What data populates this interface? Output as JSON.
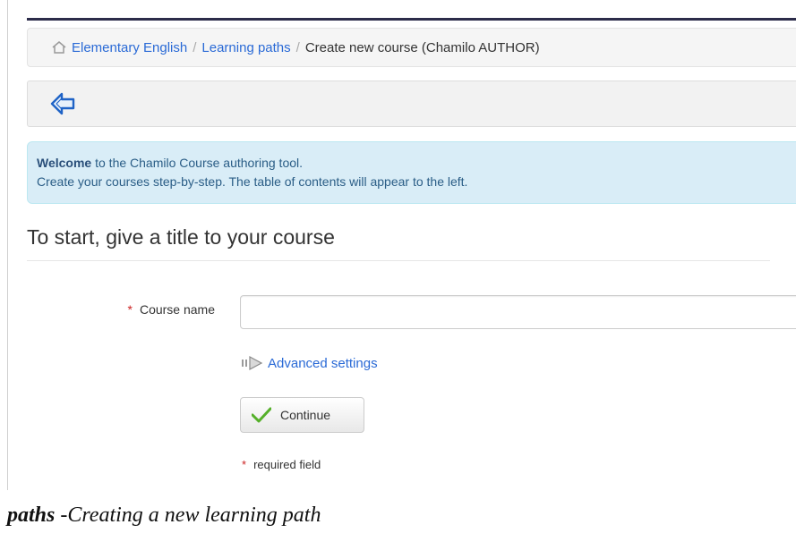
{
  "breadcrumb": {
    "items": [
      "Elementary English",
      "Learning paths"
    ],
    "separator": "/",
    "current": "Create new course (Chamilo AUTHOR)"
  },
  "alert": {
    "bold": "Welcome",
    "line1_rest": " to the Chamilo Course authoring tool.",
    "line2": "Create your courses step-by-step. The table of contents will appear to the left."
  },
  "heading": "To start, give a title to your course",
  "form": {
    "required_mark": "*",
    "course_name_label": "Course name",
    "course_name_value": "",
    "advanced_label": "Advanced settings",
    "continue_label": "Continue",
    "required_note": "required field"
  },
  "caption": {
    "bold": "paths",
    "rest": " -Creating a new learning path"
  },
  "colors": {
    "link": "#2a6ad6",
    "alert_bg": "#d9edf7",
    "required": "#cc2222",
    "check": "#55b02a"
  },
  "icons": {
    "home": "home-icon",
    "back": "back-arrow-icon",
    "advanced": "arrow-right-icon",
    "continue": "checkmark-icon"
  }
}
